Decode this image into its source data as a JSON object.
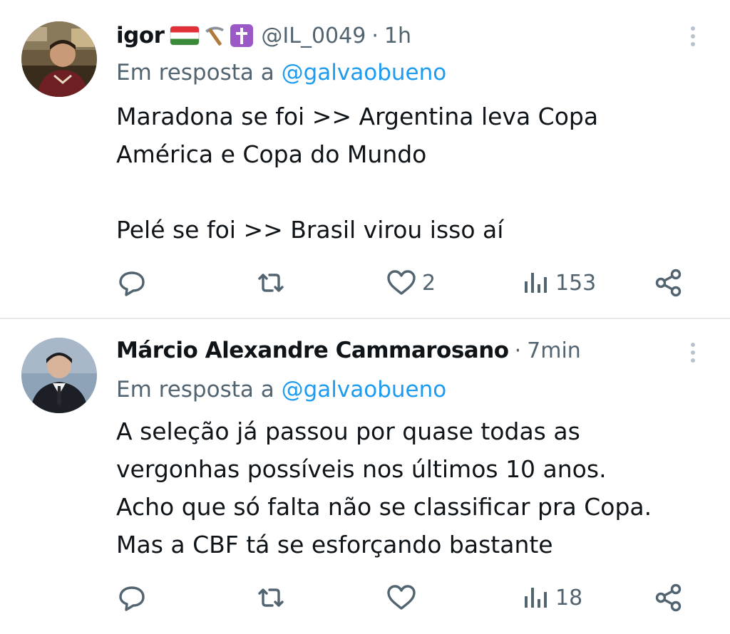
{
  "colors": {
    "text": "#0f1419",
    "secondary": "#536471",
    "link": "#1d9bf0",
    "divider": "#e7e9ea"
  },
  "tweets": [
    {
      "author_name": "igor",
      "author_emojis": [
        "hungary-flag-icon",
        "pick-icon",
        "latin-cross-icon"
      ],
      "handle": "@IL_0049",
      "separator": "·",
      "time": "1h",
      "reply_prefix": "Em resposta a",
      "reply_mention": "@galvaobueno",
      "body_lines": [
        "Maradona se foi >> Argentina leva Copa",
        "América e Copa do Mundo",
        "",
        "Pelé se foi >> Brasil virou isso aí"
      ],
      "counts": {
        "replies": "",
        "retweets": "",
        "likes": "2",
        "views": "153"
      }
    },
    {
      "author_name": "Márcio Alexandre Cammarosano",
      "author_emojis": [],
      "handle": "",
      "separator": "·",
      "time": "7min",
      "reply_prefix": "Em resposta a",
      "reply_mention": "@galvaobueno",
      "body_lines": [
        "A seleção já passou por quase todas as",
        "vergonhas possíveis nos últimos 10 anos.",
        "Acho que só falta não se classificar pra Copa.",
        "Mas a CBF tá se esforçando bastante"
      ],
      "counts": {
        "replies": "",
        "retweets": "",
        "likes": "",
        "views": "18"
      }
    }
  ]
}
